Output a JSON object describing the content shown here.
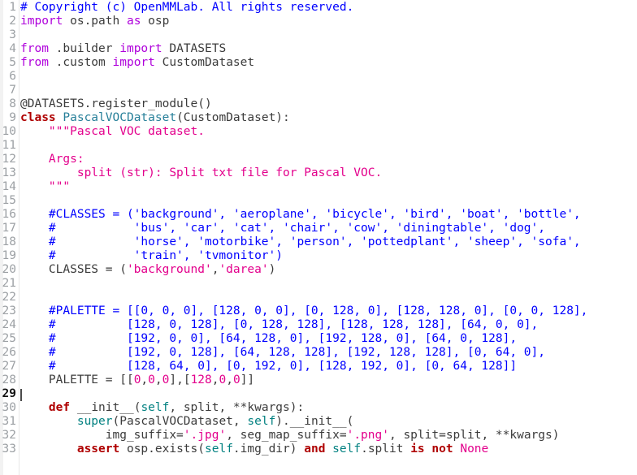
{
  "editor": {
    "name": "python-code-editor",
    "language": "Python",
    "total_lines": 33,
    "active_line": 29,
    "colors": {
      "background": "#ffffff",
      "gutter_background": "#f2f2f2",
      "gutter_separator": "#e8e8e8",
      "line_number": "#9ca0a4",
      "active_line_number": "#111111",
      "plain_text": "#3b3b3b",
      "comment": "#0000ff",
      "keyword_import": "#af00db",
      "keyword_control": "#af0000",
      "class_name": "#267f99",
      "self_keyword": "#008080",
      "string": "#e3008c",
      "number": "#e3008c",
      "caret": "#4a4a4a"
    }
  },
  "lines": [
    {
      "n": 1,
      "tokens": [
        {
          "t": "# Copyright (c) OpenMMLab. All rights reserved.",
          "c": "t-com"
        }
      ]
    },
    {
      "n": 2,
      "tokens": [
        {
          "t": "import",
          "c": "t-kw"
        },
        {
          "t": " os.path ",
          "c": "t-plain"
        },
        {
          "t": "as",
          "c": "t-kw"
        },
        {
          "t": " osp",
          "c": "t-plain"
        }
      ]
    },
    {
      "n": 3,
      "tokens": []
    },
    {
      "n": 4,
      "tokens": [
        {
          "t": "from",
          "c": "t-kw"
        },
        {
          "t": " .builder ",
          "c": "t-plain"
        },
        {
          "t": "import",
          "c": "t-kw"
        },
        {
          "t": " DATASETS",
          "c": "t-plain"
        }
      ]
    },
    {
      "n": 5,
      "tokens": [
        {
          "t": "from",
          "c": "t-kw"
        },
        {
          "t": " .custom ",
          "c": "t-plain"
        },
        {
          "t": "import",
          "c": "t-kw"
        },
        {
          "t": " CustomDataset",
          "c": "t-plain"
        }
      ]
    },
    {
      "n": 6,
      "tokens": []
    },
    {
      "n": 7,
      "tokens": []
    },
    {
      "n": 8,
      "tokens": [
        {
          "t": "@DATASETS.register_module()",
          "c": "t-dec"
        }
      ]
    },
    {
      "n": 9,
      "tokens": [
        {
          "t": "class",
          "c": "t-kw2"
        },
        {
          "t": " ",
          "c": "t-plain"
        },
        {
          "t": "PascalVOCDataset",
          "c": "t-cls"
        },
        {
          "t": "(CustomDataset):",
          "c": "t-plain"
        }
      ]
    },
    {
      "n": 10,
      "tokens": [
        {
          "t": "    \"\"\"Pascal VOC dataset.",
          "c": "t-doc"
        }
      ]
    },
    {
      "n": 11,
      "tokens": []
    },
    {
      "n": 12,
      "tokens": [
        {
          "t": "    Args:",
          "c": "t-doc"
        }
      ]
    },
    {
      "n": 13,
      "tokens": [
        {
          "t": "        split (str): Split txt file for Pascal VOC.",
          "c": "t-doc"
        }
      ]
    },
    {
      "n": 14,
      "tokens": [
        {
          "t": "    \"\"\"",
          "c": "t-doc"
        }
      ]
    },
    {
      "n": 15,
      "tokens": []
    },
    {
      "n": 16,
      "tokens": [
        {
          "t": "    #CLASSES = ('background', 'aeroplane', 'bicycle', 'bird', 'boat', 'bottle',",
          "c": "t-com"
        }
      ]
    },
    {
      "n": 17,
      "tokens": [
        {
          "t": "    #           'bus', 'car', 'cat', 'chair', 'cow', 'diningtable', 'dog',",
          "c": "t-com"
        }
      ]
    },
    {
      "n": 18,
      "tokens": [
        {
          "t": "    #           'horse', 'motorbike', 'person', 'pottedplant', 'sheep', 'sofa',",
          "c": "t-com"
        }
      ]
    },
    {
      "n": 19,
      "tokens": [
        {
          "t": "    #           'train', 'tvmonitor')",
          "c": "t-com"
        }
      ]
    },
    {
      "n": 20,
      "tokens": [
        {
          "t": "    CLASSES = (",
          "c": "t-plain"
        },
        {
          "t": "'background'",
          "c": "t-str"
        },
        {
          "t": ",",
          "c": "t-plain"
        },
        {
          "t": "'darea'",
          "c": "t-str"
        },
        {
          "t": ")",
          "c": "t-plain"
        }
      ]
    },
    {
      "n": 21,
      "tokens": []
    },
    {
      "n": 22,
      "tokens": []
    },
    {
      "n": 23,
      "tokens": [
        {
          "t": "    #PALETTE = [[0, 0, 0], [128, 0, 0], [0, 128, 0], [128, 128, 0], [0, 0, 128],",
          "c": "t-com"
        }
      ]
    },
    {
      "n": 24,
      "tokens": [
        {
          "t": "    #          [128, 0, 128], [0, 128, 128], [128, 128, 128], [64, 0, 0],",
          "c": "t-com"
        }
      ]
    },
    {
      "n": 25,
      "tokens": [
        {
          "t": "    #          [192, 0, 0], [64, 128, 0], [192, 128, 0], [64, 0, 128],",
          "c": "t-com"
        }
      ]
    },
    {
      "n": 26,
      "tokens": [
        {
          "t": "    #          [192, 0, 128], [64, 128, 128], [192, 128, 128], [0, 64, 0],",
          "c": "t-com"
        }
      ]
    },
    {
      "n": 27,
      "tokens": [
        {
          "t": "    #          [128, 64, 0], [0, 192, 0], [128, 192, 0], [0, 64, 128]]",
          "c": "t-com"
        }
      ]
    },
    {
      "n": 28,
      "tokens": [
        {
          "t": "    PALETTE = [[",
          "c": "t-plain"
        },
        {
          "t": "0",
          "c": "t-num"
        },
        {
          "t": ",",
          "c": "t-plain"
        },
        {
          "t": "0",
          "c": "t-num"
        },
        {
          "t": ",",
          "c": "t-plain"
        },
        {
          "t": "0",
          "c": "t-num"
        },
        {
          "t": "],[",
          "c": "t-plain"
        },
        {
          "t": "128",
          "c": "t-num"
        },
        {
          "t": ",",
          "c": "t-plain"
        },
        {
          "t": "0",
          "c": "t-num"
        },
        {
          "t": ",",
          "c": "t-plain"
        },
        {
          "t": "0",
          "c": "t-num"
        },
        {
          "t": "]]",
          "c": "t-plain"
        }
      ]
    },
    {
      "n": 29,
      "tokens": []
    },
    {
      "n": 30,
      "tokens": [
        {
          "t": "    ",
          "c": "t-plain"
        },
        {
          "t": "def",
          "c": "t-kw2"
        },
        {
          "t": " __init__(",
          "c": "t-plain"
        },
        {
          "t": "self",
          "c": "t-self"
        },
        {
          "t": ", split, **kwargs):",
          "c": "t-plain"
        }
      ]
    },
    {
      "n": 31,
      "tokens": [
        {
          "t": "        ",
          "c": "t-plain"
        },
        {
          "t": "super",
          "c": "t-self"
        },
        {
          "t": "(PascalVOCDataset, ",
          "c": "t-plain"
        },
        {
          "t": "self",
          "c": "t-self"
        },
        {
          "t": ").__init__(",
          "c": "t-plain"
        }
      ]
    },
    {
      "n": 32,
      "tokens": [
        {
          "t": "            img_suffix=",
          "c": "t-plain"
        },
        {
          "t": "'.jpg'",
          "c": "t-str"
        },
        {
          "t": ", seg_map_suffix=",
          "c": "t-plain"
        },
        {
          "t": "'.png'",
          "c": "t-str"
        },
        {
          "t": ", split=split, **kwargs)",
          "c": "t-plain"
        }
      ]
    },
    {
      "n": 33,
      "tokens": [
        {
          "t": "        ",
          "c": "t-plain"
        },
        {
          "t": "assert",
          "c": "t-kw2"
        },
        {
          "t": " osp.exists(",
          "c": "t-plain"
        },
        {
          "t": "self",
          "c": "t-self"
        },
        {
          "t": ".img_dir) ",
          "c": "t-plain"
        },
        {
          "t": "and",
          "c": "t-kw2"
        },
        {
          "t": " ",
          "c": "t-plain"
        },
        {
          "t": "self",
          "c": "t-self"
        },
        {
          "t": ".split ",
          "c": "t-plain"
        },
        {
          "t": "is",
          "c": "t-kw2"
        },
        {
          "t": " ",
          "c": "t-plain"
        },
        {
          "t": "not",
          "c": "t-kw2"
        },
        {
          "t": " ",
          "c": "t-plain"
        },
        {
          "t": "None",
          "c": "t-str"
        }
      ]
    }
  ]
}
